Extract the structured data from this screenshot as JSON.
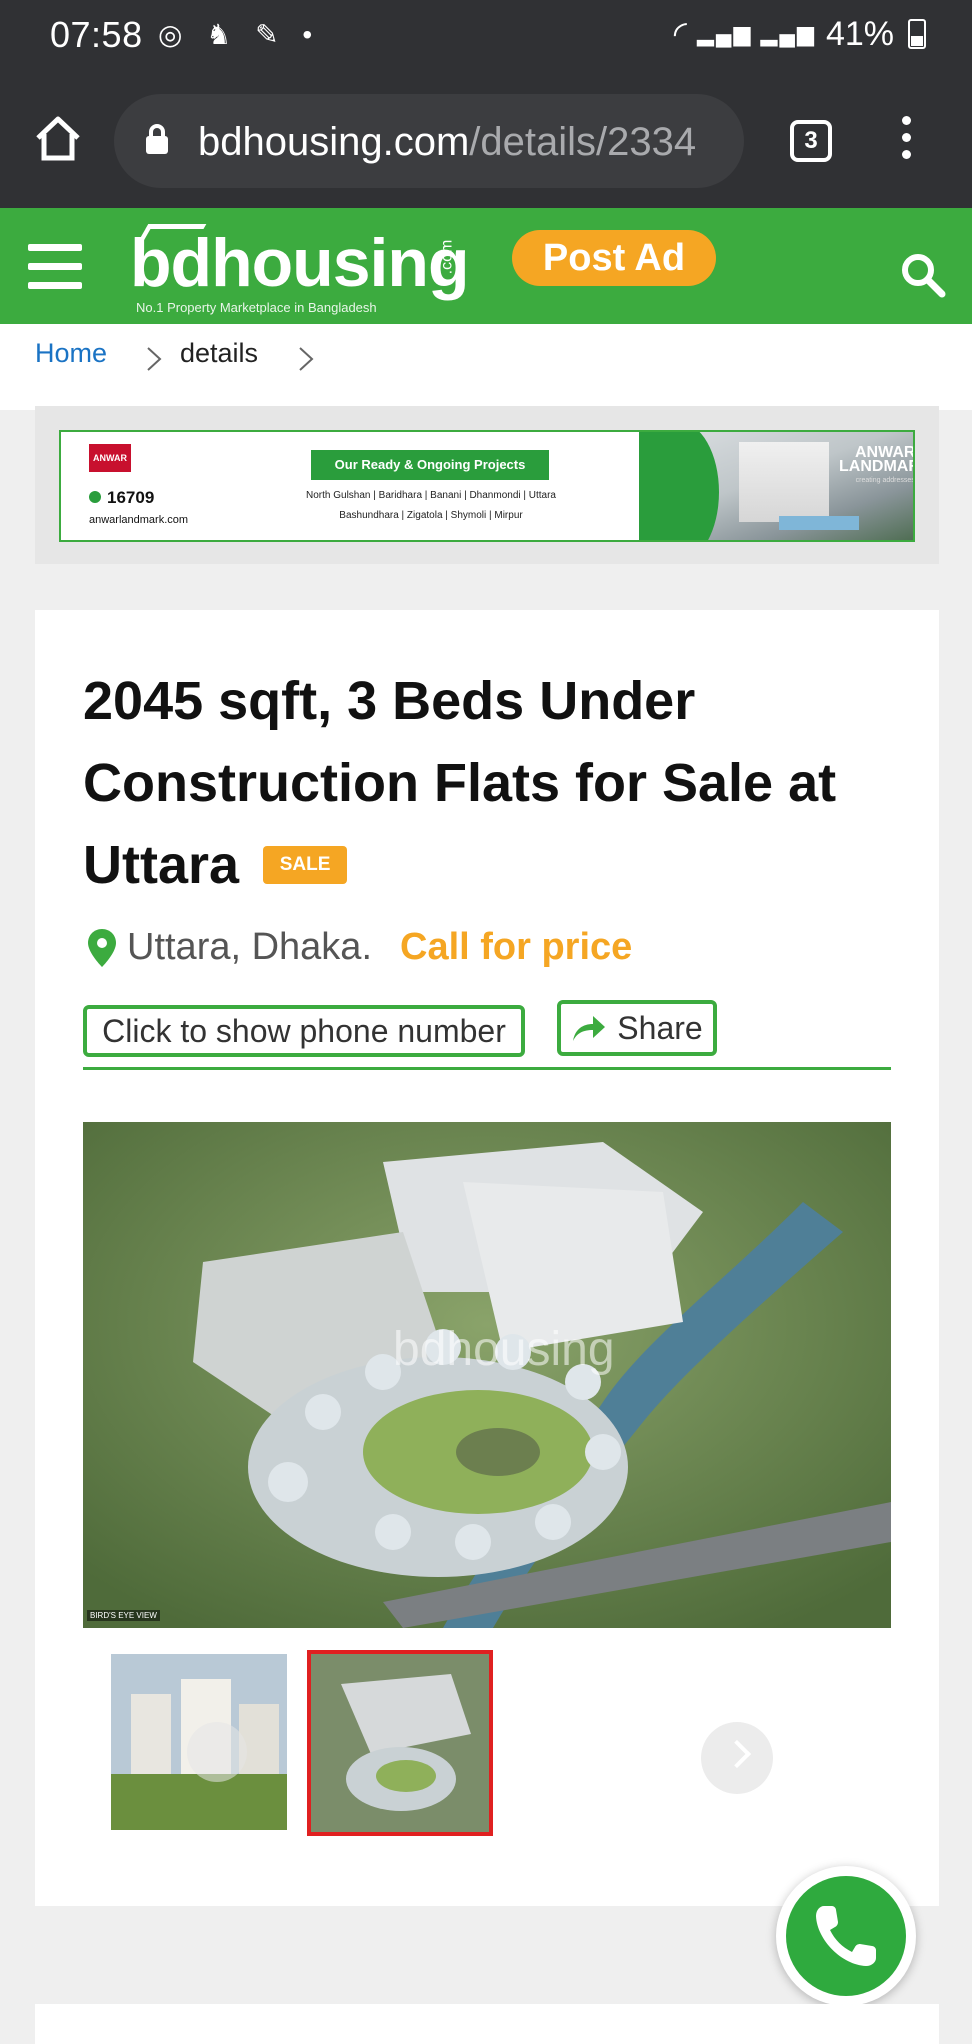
{
  "status_bar": {
    "time": "07:58",
    "battery": "41%"
  },
  "browser": {
    "url_host": "bdhousing.com",
    "url_path": "/details/2334",
    "tab_count": "3"
  },
  "site_header": {
    "logo_prefix": "bd",
    "logo_name": "housing",
    "logo_tagline": "No.1 Property Marketplace in Bangladesh",
    "logo_tld": ".com",
    "post_ad_label": "Post Ad"
  },
  "breadcrumb": {
    "home": "Home",
    "current": "details"
  },
  "banner_ad": {
    "brand_badge": "ANWAR",
    "phone": "16709",
    "website": "anwarlandmark.com",
    "headline": "Our Ready & Ongoing Projects",
    "areas_line1": "North Gulshan | Baridhara | Banani | Dhanmondi | Uttara",
    "areas_line2": "Bashundhara | Zigatola | Shymoli | Mirpur",
    "brand_name": "ANWAR LANDMARK",
    "brand_tagline": "creating addresses"
  },
  "listing": {
    "title": "2045 sqft, 3 Beds Under Construction Flats for Sale at Uttara",
    "badge": "SALE",
    "location": "Uttara, Dhaka.",
    "price": "Call for price",
    "phone_button": "Click to show phone number",
    "share_button": "Share",
    "image_watermark": "bdhousing",
    "image_caption": "BIRD'S EYE VIEW",
    "selected_thumbnail": 2
  },
  "colors": {
    "brand_green": "#3cab3f",
    "accent_orange": "#f5a623",
    "link_blue": "#1a73c4",
    "thumb_selected": "#e02020"
  },
  "icons": [
    "home-icon",
    "lock-icon",
    "tabs-icon",
    "more-icon",
    "hamburger-icon",
    "search-icon",
    "chevron-right-icon",
    "location-pin-icon",
    "share-arrow-icon",
    "phone-icon"
  ]
}
